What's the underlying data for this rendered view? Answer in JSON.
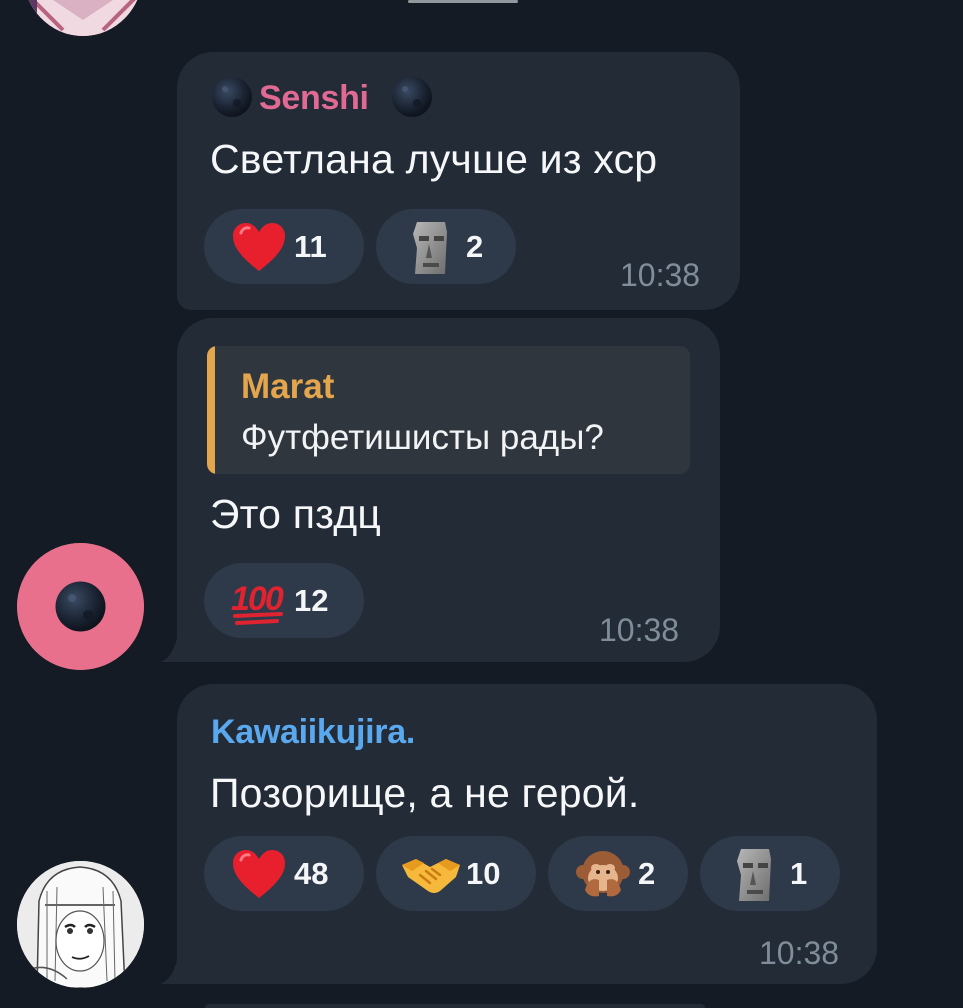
{
  "messages": [
    {
      "sender": "Senshi",
      "sender_color": "#e06a93",
      "text": "Светлана лучше из хср",
      "time": "10:38",
      "reactions": [
        {
          "emoji": "heart-icon",
          "count": "11"
        },
        {
          "emoji": "moai-icon",
          "count": "2"
        }
      ]
    },
    {
      "reply": {
        "author": "Marat",
        "author_color": "#e3a64d",
        "text": "Футфетишисты рады?"
      },
      "text": "Это пздц",
      "time": "10:38",
      "reactions": [
        {
          "emoji": "hundred-points-icon",
          "count": "12"
        }
      ]
    },
    {
      "sender": "Kawaiikujira.",
      "sender_color": "#5aa9ee",
      "text": "Позорище, а не герой.",
      "time": "10:38",
      "reactions": [
        {
          "emoji": "heart-icon",
          "count": "48"
        },
        {
          "emoji": "handshake-icon",
          "count": "10"
        },
        {
          "emoji": "see-no-evil-monkey-icon",
          "count": "2"
        },
        {
          "emoji": "moai-icon",
          "count": "1"
        }
      ]
    }
  ]
}
